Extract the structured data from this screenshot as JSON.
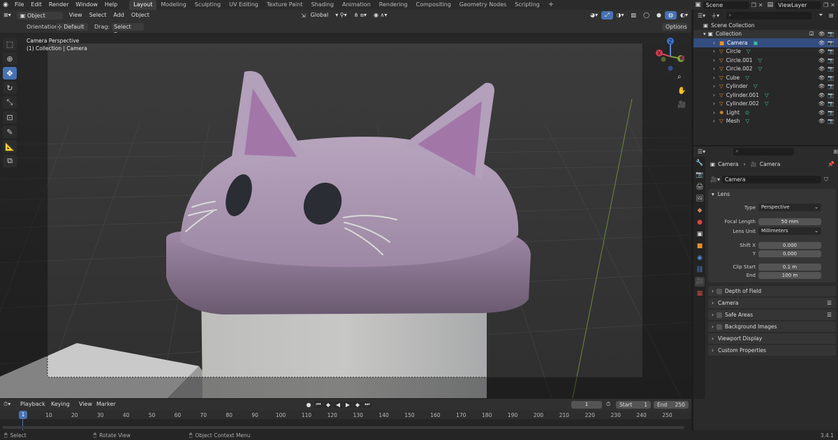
{
  "menu": [
    "File",
    "Edit",
    "Render",
    "Window",
    "Help"
  ],
  "workspaces": [
    {
      "label": "Layout",
      "active": true
    },
    {
      "label": "Modeling"
    },
    {
      "label": "Sculpting"
    },
    {
      "label": "UV Editing"
    },
    {
      "label": "Texture Paint"
    },
    {
      "label": "Shading"
    },
    {
      "label": "Animation"
    },
    {
      "label": "Rendering"
    },
    {
      "label": "Compositing"
    },
    {
      "label": "Geometry Nodes"
    },
    {
      "label": "Scripting"
    }
  ],
  "add_workspace": "+",
  "scene": {
    "name": "Scene"
  },
  "view_layer": {
    "name": "ViewLayer"
  },
  "viewport_header": {
    "mode": "Object Mode",
    "menus": [
      "View",
      "Select",
      "Add",
      "Object"
    ],
    "transform_orientation": "Global",
    "options": "Options"
  },
  "viewport_subheader": {
    "orientation_label": "Orientation:",
    "orientation_value": "Default",
    "drag_label": "Drag:",
    "drag_value": "Select Box"
  },
  "viewport_info": {
    "line1": "Camera Perspective",
    "line2": "(1) Collection | Camera"
  },
  "gizmo_axes": {
    "x": "X",
    "y": "Y",
    "z": "Z"
  },
  "outliner": {
    "root": "Scene Collection",
    "collection": "Collection",
    "items": [
      "Camera",
      "Circle",
      "Circle.001",
      "Circle.002",
      "Cube",
      "Cylinder",
      "Cylinder.001",
      "Cylinder.002",
      "Light",
      "Mesh"
    ]
  },
  "properties": {
    "breadcrumb_object": "Camera",
    "breadcrumb_data": "Camera",
    "datablock_name": "Camera",
    "lens_panel": "Lens",
    "type_label": "Type",
    "type_value": "Perspective",
    "focal_length_label": "Focal Length",
    "focal_length_value": "50 mm",
    "lens_unit_label": "Lens Unit",
    "lens_unit_value": "Millimeters",
    "shift_x_label": "Shift X",
    "shift_x_value": "0.000",
    "shift_y_label": "Y",
    "shift_y_value": "0.000",
    "clip_start_label": "Clip Start",
    "clip_start_value": "0.1 m",
    "clip_end_label": "End",
    "clip_end_value": "100 m",
    "panels": [
      "Depth of Field",
      "Camera",
      "Safe Areas",
      "Background Images",
      "Viewport Display",
      "Custom Properties"
    ]
  },
  "timeline": {
    "menus": [
      "Playback",
      "Keying",
      "View",
      "Marker"
    ],
    "current_frame": "1",
    "start_label": "Start",
    "start_value": "1",
    "end_label": "End",
    "end_value": "250",
    "playhead": "1",
    "ticks": [
      "10",
      "20",
      "30",
      "40",
      "50",
      "60",
      "70",
      "80",
      "90",
      "100",
      "110",
      "120",
      "130",
      "140",
      "150",
      "160",
      "170",
      "180",
      "190",
      "200",
      "210",
      "220",
      "230",
      "240",
      "250"
    ]
  },
  "statusbar": {
    "select": "Select",
    "rotate": "Rotate View",
    "context_menu": "Object Context Menu",
    "version": "3.4.1"
  },
  "colors": {
    "accent": "#4772b3",
    "cat_purple": "#a48bb0",
    "cup_white": "#c8c8c6"
  }
}
